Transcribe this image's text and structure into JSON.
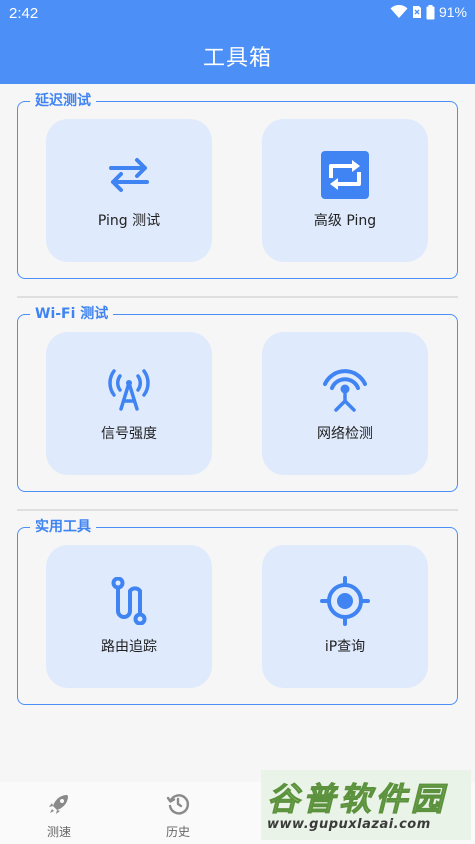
{
  "status": {
    "time": "2:42",
    "battery": "91%"
  },
  "page": {
    "title": "工具箱"
  },
  "sections": [
    {
      "label": "延迟测试",
      "cards": [
        {
          "label": "Ping 测试",
          "icon": "swap-arrows-icon"
        },
        {
          "label": "高级 Ping",
          "icon": "repeat-square-icon"
        }
      ]
    },
    {
      "label": "Wi-Fi 测试",
      "cards": [
        {
          "label": "信号强度",
          "icon": "signal-antenna-icon"
        },
        {
          "label": "网络检测",
          "icon": "network-tower-icon"
        }
      ]
    },
    {
      "label": "实用工具",
      "cards": [
        {
          "label": "路由追踪",
          "icon": "route-icon"
        },
        {
          "label": "iP查询",
          "icon": "locate-target-icon"
        }
      ]
    }
  ],
  "bottom_nav": [
    {
      "label": "测速",
      "icon": "rocket-icon"
    },
    {
      "label": "历史",
      "icon": "history-icon"
    }
  ],
  "watermark": {
    "title": "谷普软件园",
    "url": "www.gupuxlazai.com"
  },
  "colors": {
    "primary": "#4b8ff7",
    "card_bg": "#dfeafd",
    "icon": "#3f84f2"
  }
}
